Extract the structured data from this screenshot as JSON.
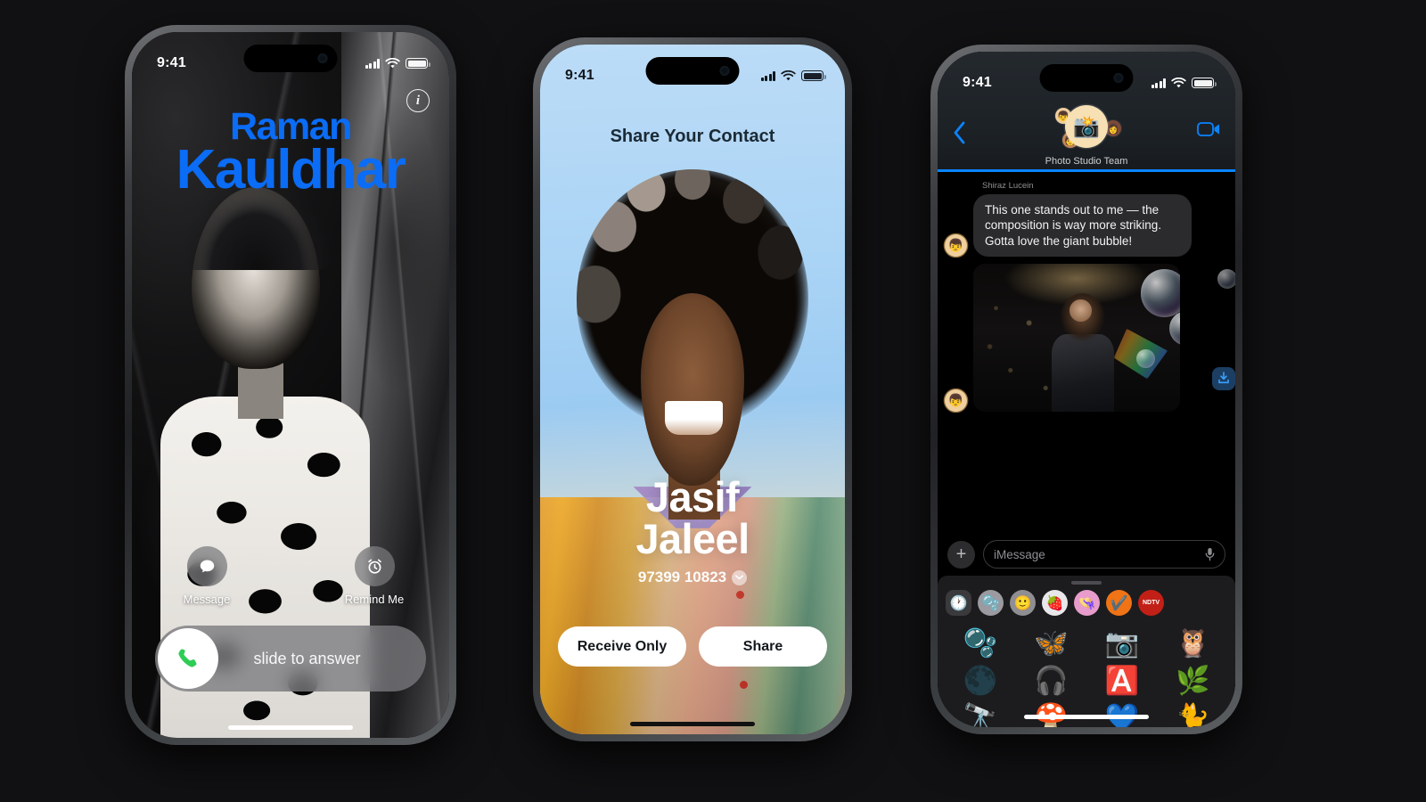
{
  "background_color": "#111113",
  "phone1": {
    "name": "incoming-call-contact-poster",
    "status": {
      "time": "9:41",
      "signal_icon": "cellular-bars-icon",
      "wifi_icon": "wifi-icon",
      "battery_icon": "battery-icon"
    },
    "info_button_label": "i",
    "caller": {
      "first_name": "Raman",
      "last_name": "Kauldhar",
      "name_color": "#0b6cf5"
    },
    "actions": [
      {
        "icon": "message-bubble-icon",
        "glyph": "💬",
        "label": "Message"
      },
      {
        "icon": "alarm-clock-icon",
        "glyph": "⏰",
        "label": "Remind Me"
      }
    ],
    "slider": {
      "icon": "phone-handset-icon",
      "label": "slide to answer",
      "accent": "#30d158"
    }
  },
  "phone2": {
    "name": "share-contact-poster",
    "status": {
      "time": "9:41",
      "signal_icon": "cellular-bars-icon",
      "wifi_icon": "wifi-icon",
      "battery_icon": "battery-icon"
    },
    "title": "Share Your Contact",
    "contact": {
      "first_name": "Jasif",
      "last_name": "Jaleel",
      "phone": "97399 10823",
      "chevron_icon": "chevron-down-icon"
    },
    "buttons": [
      {
        "label": "Receive Only",
        "name": "receive-only-button"
      },
      {
        "label": "Share",
        "name": "share-button"
      }
    ]
  },
  "phone3": {
    "name": "messages-conversation",
    "status": {
      "time": "9:41",
      "signal_icon": "cellular-bars-icon",
      "wifi_icon": "wifi-icon",
      "battery_icon": "battery-icon"
    },
    "header": {
      "back_icon": "chevron-left-icon",
      "facetime_icon": "video-camera-icon",
      "group_name": "Photo Studio Team",
      "group_avatar_glyph": "📸",
      "member_avatars": [
        "👦",
        "👩",
        "🧑"
      ]
    },
    "messages": [
      {
        "sender": "Shiraz Lucein",
        "avatar_glyph": "👦",
        "text": "This one stands out to me — the composition is way more striking. Gotta love the giant bubble!"
      }
    ],
    "photo_attachment": {
      "name": "photo-bubbles-attachment",
      "save_icon": "save-to-photos-icon"
    },
    "input": {
      "plus_icon": "plus-icon",
      "placeholder": "iMessage",
      "mic_icon": "microphone-icon"
    },
    "sticker_drawer": {
      "grabber": "drag-handle",
      "categories": [
        {
          "name": "recents-tab",
          "glyph": "🕐",
          "selected": true
        },
        {
          "name": "memoji-tab",
          "glyph": "🫧",
          "selected": false
        },
        {
          "name": "emoji-tab",
          "glyph": "🙂",
          "selected": false
        },
        {
          "name": "photo-stickers-tab",
          "glyph": "🍓",
          "selected": false
        },
        {
          "name": "sticker-pack-pink-tab",
          "glyph": "👒",
          "selected": false
        },
        {
          "name": "checkmark-pack-tab",
          "glyph": "✔️",
          "selected": false
        },
        {
          "name": "ndtv-pack-tab",
          "glyph": "NDTV",
          "selected": false
        }
      ],
      "stickers": [
        {
          "name": "bubbles-sticker",
          "glyph": "🫧"
        },
        {
          "name": "butterfly-sticker",
          "glyph": "🦋"
        },
        {
          "name": "camera-sticker",
          "glyph": "📷"
        },
        {
          "name": "owl-sticker",
          "glyph": "🦉"
        },
        {
          "name": "moon-sticker",
          "glyph": "🌑"
        },
        {
          "name": "headphones-sticker",
          "glyph": "🎧"
        },
        {
          "name": "a-plus-sticker",
          "glyph": "🅰️"
        },
        {
          "name": "monstera-leaf-sticker",
          "glyph": "🌿"
        },
        {
          "name": "telescope-sticker",
          "glyph": "🔭"
        },
        {
          "name": "mushroom-character-sticker",
          "glyph": "🍄"
        },
        {
          "name": "blue-heart-sticker",
          "glyph": "💙"
        },
        {
          "name": "cat-sticker",
          "glyph": "🐈"
        }
      ]
    }
  }
}
